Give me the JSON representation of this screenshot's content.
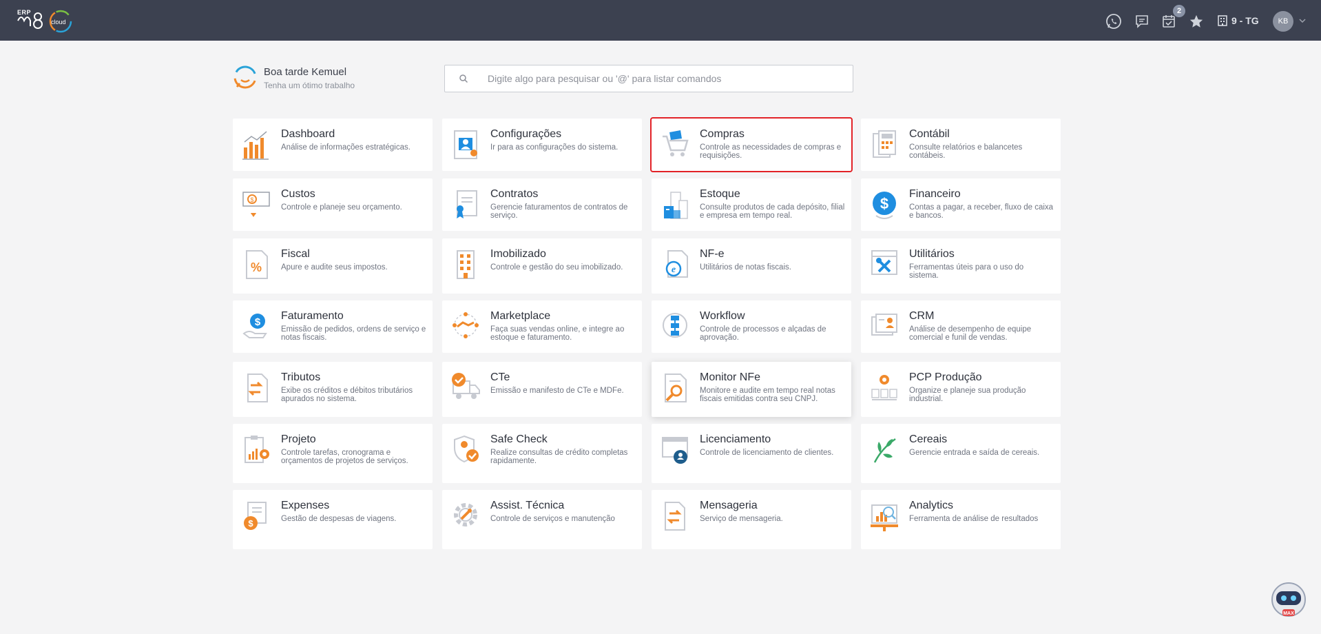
{
  "header": {
    "logo_text": "ERP",
    "logo_cloud": "cloud",
    "notification_count": "2",
    "company": "9 - TG",
    "user_initials": "KB"
  },
  "greeting": {
    "title": "Boa tarde Kemuel",
    "subtitle": "Tenha um ótimo trabalho"
  },
  "search": {
    "placeholder": "Digite algo para pesquisar ou '@' para listar comandos"
  },
  "modules": [
    {
      "title": "Dashboard",
      "desc": "Análise de informações estratégicas.",
      "icon": "dashboard-icon"
    },
    {
      "title": "Configurações",
      "desc": "Ir para as configurações do sistema.",
      "icon": "settings-icon"
    },
    {
      "title": "Compras",
      "desc": "Controle as necessidades de compras e requisições.",
      "icon": "cart-icon"
    },
    {
      "title": "Contábil",
      "desc": "Consulte relatórios e balancetes contábeis.",
      "icon": "calculator-icon"
    },
    {
      "title": "Custos",
      "desc": "Controle e planeje seu orçamento.",
      "icon": "money-icon"
    },
    {
      "title": "Contratos",
      "desc": "Gerencie faturamentos de contratos de serviço.",
      "icon": "contract-icon"
    },
    {
      "title": "Estoque",
      "desc": "Consulte produtos de cada depósito, filial e empresa em tempo real.",
      "icon": "warehouse-icon"
    },
    {
      "title": "Financeiro",
      "desc": "Contas a pagar, a receber, fluxo de caixa e bancos.",
      "icon": "dollar-coin-icon"
    },
    {
      "title": "Fiscal",
      "desc": "Apure e audite seus impostos.",
      "icon": "percent-doc-icon"
    },
    {
      "title": "Imobilizado",
      "desc": "Controle e gestão do seu imobilizado.",
      "icon": "building-icon"
    },
    {
      "title": "NF-e",
      "desc": "Utilitários de notas fiscais.",
      "icon": "nfe-icon"
    },
    {
      "title": "Utilitários",
      "desc": "Ferramentas úteis para o uso do sistema.",
      "icon": "tools-icon"
    },
    {
      "title": "Faturamento",
      "desc": "Emissão de pedidos, ordens de serviço e notas fiscais.",
      "icon": "billing-icon"
    },
    {
      "title": "Marketplace",
      "desc": "Faça suas vendas online, e integre ao estoque e faturamento.",
      "icon": "handshake-icon"
    },
    {
      "title": "Workflow",
      "desc": "Controle de processos e alçadas de aprovação.",
      "icon": "workflow-icon"
    },
    {
      "title": "CRM",
      "desc": "Análise de desempenho de equipe comercial e funil de vendas.",
      "icon": "crm-icon"
    },
    {
      "title": "Tributos",
      "desc": "Exibe os créditos e débitos tributários apurados no sistema.",
      "icon": "exchange-doc-icon"
    },
    {
      "title": "CTe",
      "desc": "Emissão e manifesto de CTe e MDFe.",
      "icon": "truck-icon"
    },
    {
      "title": "Monitor NFe",
      "desc": "Monitore e audite em tempo real notas fiscais emitidas contra seu CNPJ.",
      "icon": "magnifier-doc-icon"
    },
    {
      "title": "PCP Produção",
      "desc": "Organize e planeje sua produção industrial.",
      "icon": "production-icon"
    },
    {
      "title": "Projeto",
      "desc": "Controle tarefas, cronograma e orçamentos de projetos de serviços.",
      "icon": "project-icon"
    },
    {
      "title": "Safe Check",
      "desc": "Realize consultas de crédito completas rapidamente.",
      "icon": "shield-check-icon"
    },
    {
      "title": "Licenciamento",
      "desc": "Controle de licenciamento de clientes.",
      "icon": "license-icon"
    },
    {
      "title": "Cereais",
      "desc": "Gerencie entrada e saída de cereais.",
      "icon": "leaf-icon"
    },
    {
      "title": "Expenses",
      "desc": "Gestão de despesas de viagens.",
      "icon": "expenses-icon"
    },
    {
      "title": "Assist. Técnica",
      "desc": "Controle de serviços e manutenção",
      "icon": "gear-service-icon"
    },
    {
      "title": "Mensageria",
      "desc": "Serviço de mensageria.",
      "icon": "messaging-icon"
    },
    {
      "title": "Analytics",
      "desc": "Ferramenta de análise de resultados",
      "icon": "analytics-icon"
    }
  ],
  "colors": {
    "topbar": "#3c4150",
    "accent_orange": "#f08a2c",
    "accent_blue": "#1f8ee0",
    "selection": "#e22227"
  }
}
